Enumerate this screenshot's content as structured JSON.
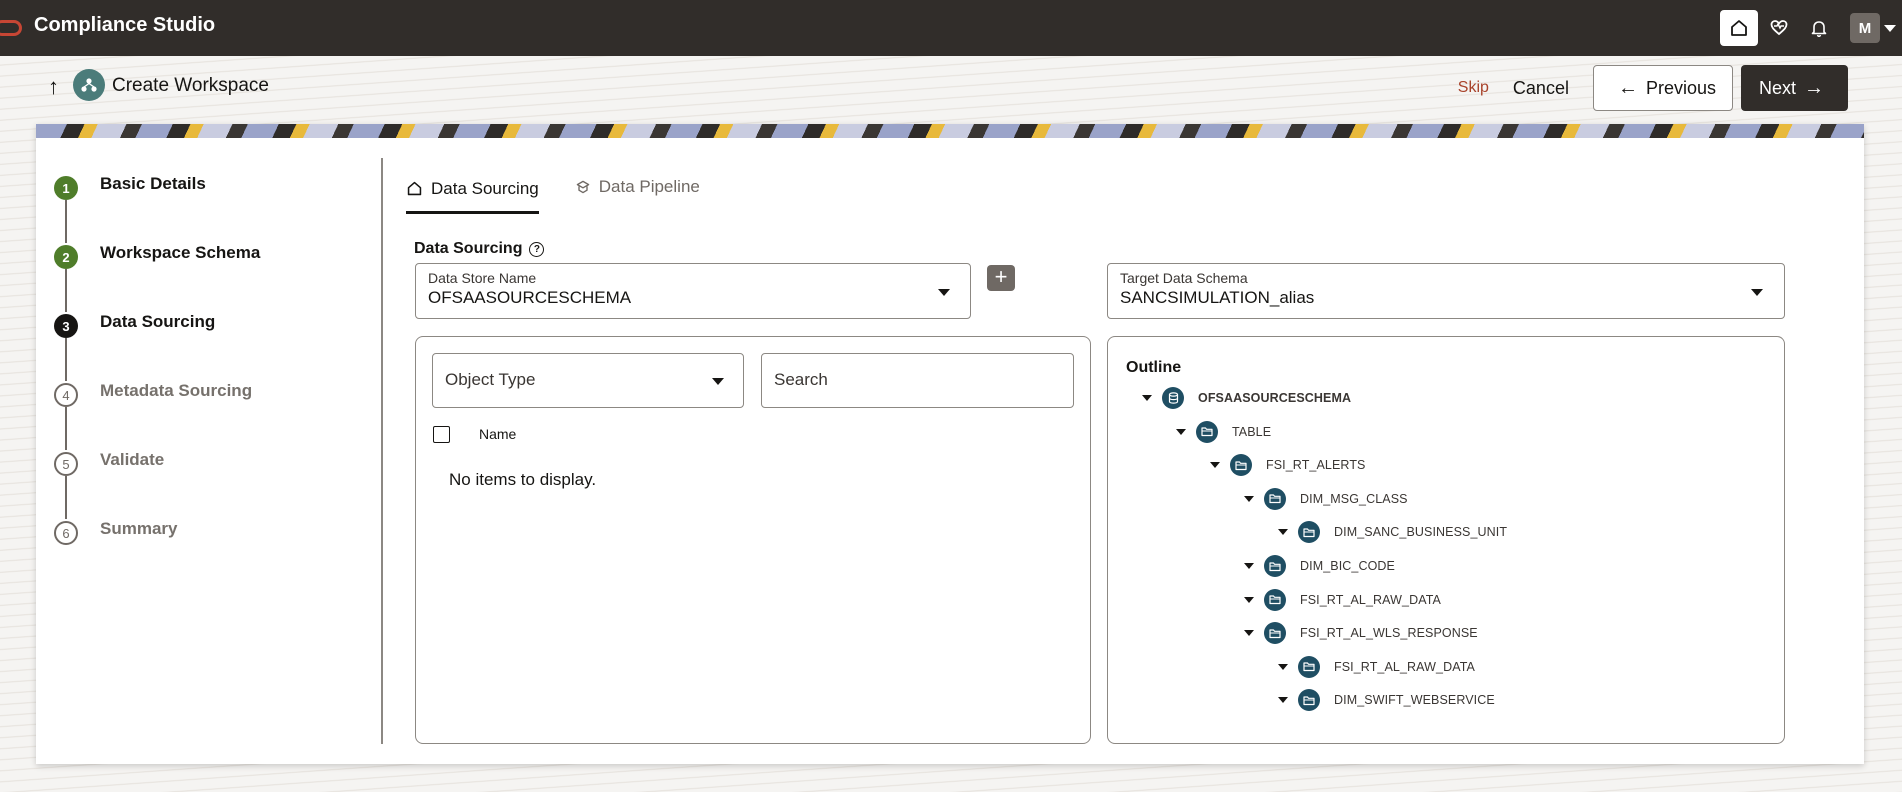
{
  "app": {
    "title": "Compliance Studio",
    "user_initial": "M"
  },
  "topbar": {
    "icons": [
      "home-icon",
      "heart-icon",
      "bell-icon"
    ]
  },
  "header": {
    "title": "Create Workspace",
    "skip_label": "Skip",
    "cancel_label": "Cancel",
    "previous_label": "Previous",
    "next_label": "Next"
  },
  "steps": [
    {
      "num": "1",
      "label": "Basic Details",
      "state": "done"
    },
    {
      "num": "2",
      "label": "Workspace Schema",
      "state": "done"
    },
    {
      "num": "3",
      "label": "Data Sourcing",
      "state": "current"
    },
    {
      "num": "4",
      "label": "Metadata Sourcing",
      "state": "todo"
    },
    {
      "num": "5",
      "label": "Validate",
      "state": "todo"
    },
    {
      "num": "6",
      "label": "Summary",
      "state": "todo"
    }
  ],
  "tabs": [
    {
      "label": "Data Sourcing",
      "active": true
    },
    {
      "label": "Data Pipeline",
      "active": false
    }
  ],
  "section": {
    "title": "Data Sourcing",
    "help": "?"
  },
  "data_store": {
    "label": "Data Store Name",
    "value": "OFSAASOURCESCHEMA"
  },
  "target_schema": {
    "label": "Target Data Schema",
    "value": "SANCSIMULATION_alias"
  },
  "left_panel": {
    "object_type_placeholder": "Object Type",
    "search_placeholder": "Search",
    "column_name": "Name",
    "empty_text": "No items to display."
  },
  "outline": {
    "title": "Outline",
    "nodes": [
      {
        "label": "OFSAASOURCESCHEMA",
        "level": 0,
        "kind": "database"
      },
      {
        "label": "TABLE",
        "level": 1,
        "kind": "folder"
      },
      {
        "label": "FSI_RT_ALERTS",
        "level": 2,
        "kind": "folder"
      },
      {
        "label": "DIM_MSG_CLASS",
        "level": 3,
        "kind": "folder"
      },
      {
        "label": "DIM_SANC_BUSINESS_UNIT",
        "level": 4,
        "kind": "folder"
      },
      {
        "label": "DIM_BIC_CODE",
        "level": 3,
        "kind": "folder"
      },
      {
        "label": "FSI_RT_AL_RAW_DATA",
        "level": 3,
        "kind": "folder"
      },
      {
        "label": "FSI_RT_AL_WLS_RESPONSE",
        "level": 3,
        "kind": "folder"
      },
      {
        "label": "FSI_RT_AL_RAW_DATA",
        "level": 4,
        "kind": "folder"
      },
      {
        "label": "DIM_SWIFT_WEBSERVICE",
        "level": 4,
        "kind": "folder"
      }
    ]
  }
}
